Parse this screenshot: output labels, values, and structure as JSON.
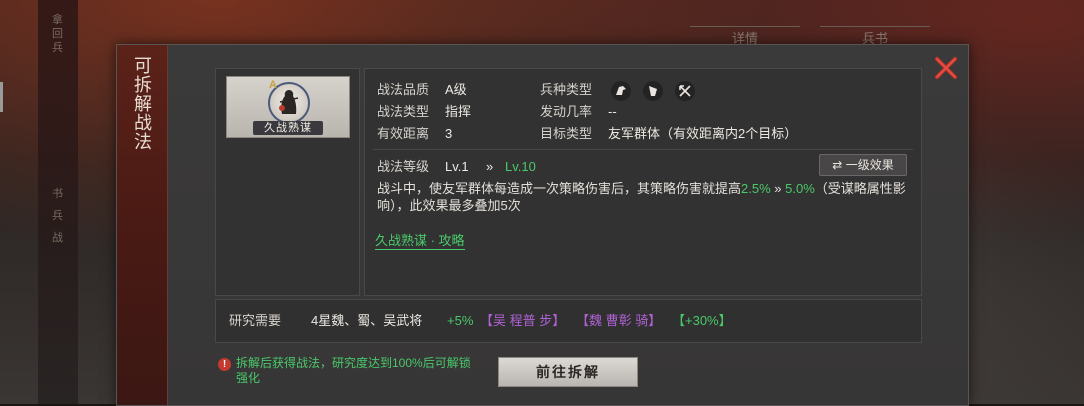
{
  "background": {
    "tabs": [
      "详情",
      "兵书"
    ],
    "side_labels": [
      "拿",
      "回",
      "兵",
      "书",
      "兵",
      "战"
    ]
  },
  "modal": {
    "title": "可拆解战法",
    "close_icon": "close-x-icon",
    "skill": {
      "name": "久战熟谋",
      "grade_letter": "A"
    },
    "attributes": {
      "quality_label": "战法品质",
      "quality_value": "A级",
      "type_label": "战法类型",
      "type_value": "指挥",
      "range_label": "有效距离",
      "range_value": "3",
      "troop_label": "兵种类型",
      "troop_icons": [
        "cavalry-icon",
        "shield-icon",
        "archer-icon"
      ],
      "trigger_label": "发动几率",
      "trigger_value": "--",
      "target_label": "目标类型",
      "target_value": "友军群体（有效距离内2个目标）"
    },
    "level": {
      "label": "战法等级",
      "current": "Lv.1",
      "arrow": "»",
      "max": "Lv.10"
    },
    "effect_button": {
      "icon": "swap-arrows-icon",
      "label": "一级效果"
    },
    "description": {
      "part1": "战斗中，使友军群体每造成一次策略伤害后，其策略伤害就提高",
      "value_low": "2.5%",
      "arrow": "»",
      "value_high": "5.0%",
      "part2": "（受谋略属性影响），此效果最多叠加5次"
    },
    "strategy_link": "久战熟谋 · 攻略",
    "research": {
      "label": "研究需要",
      "requirement": "4星魏、蜀、吴武将",
      "bonus1": "+5%",
      "generals1": "【吴 程普 步】",
      "generals2": "【魏 曹彰 骑】",
      "bonus2": "【+30%】"
    },
    "warning": {
      "icon": "warning-icon",
      "text": "拆解后获得战法，研究度达到100%后可解锁强化"
    },
    "go_button": "前往拆解"
  }
}
